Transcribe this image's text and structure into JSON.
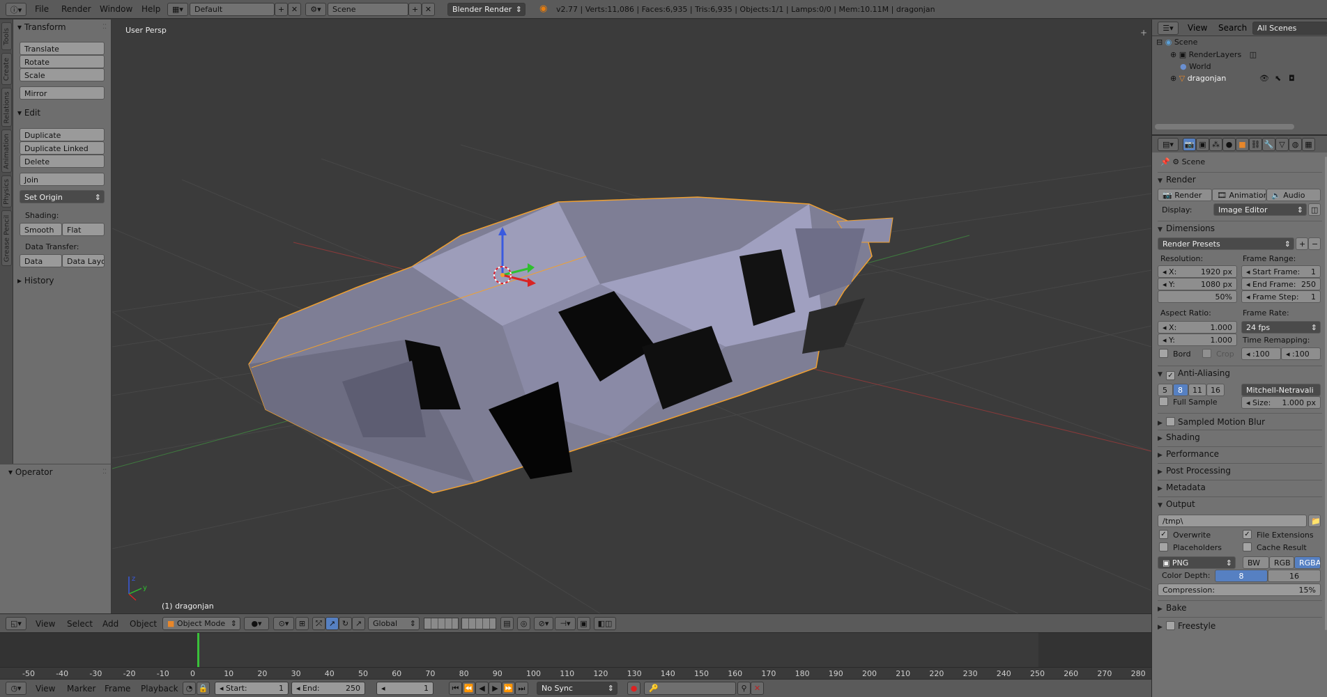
{
  "topbar": {
    "menus": [
      "File",
      "Render",
      "Window",
      "Help"
    ],
    "layout": "Default",
    "scene": "Scene",
    "engine": "Blender Render",
    "stats": "v2.77 | Verts:11,086 | Faces:6,935 | Tris:6,935 | Objects:1/1 | Lamps:0/0 | Mem:10.11M | dragonjan"
  },
  "tabs": [
    "Tools",
    "Create",
    "Relations",
    "Animation",
    "Physics",
    "Grease Pencil"
  ],
  "toolshelf": {
    "transform_header": "Transform",
    "translate": "Translate",
    "rotate": "Rotate",
    "scale": "Scale",
    "mirror": "Mirror",
    "edit_header": "Edit",
    "duplicate": "Duplicate",
    "duplicate_linked": "Duplicate Linked",
    "delete": "Delete",
    "join": "Join",
    "set_origin": "Set Origin",
    "shading_label": "Shading:",
    "smooth": "Smooth",
    "flat": "Flat",
    "data_transfer_label": "Data Transfer:",
    "data": "Data",
    "data_layout": "Data Layo",
    "history_header": "History",
    "operator_header": "Operator"
  },
  "viewport": {
    "view_name": "User Persp",
    "object_label": "(1) dragonjan"
  },
  "viewheader": {
    "menus": [
      "View",
      "Select",
      "Add",
      "Object"
    ],
    "mode": "Object Mode",
    "orientation": "Global"
  },
  "timeline": {
    "ticks": [
      "-50",
      "-40",
      "-30",
      "-20",
      "-10",
      "0",
      "10",
      "20",
      "30",
      "40",
      "50",
      "60",
      "70",
      "80",
      "90",
      "100",
      "110",
      "120",
      "130",
      "140",
      "150",
      "160",
      "170",
      "180",
      "190",
      "200",
      "210",
      "220",
      "230",
      "240",
      "250",
      "260",
      "270",
      "280"
    ],
    "current_frame": 1
  },
  "tlheader": {
    "menus": [
      "View",
      "Marker",
      "Frame",
      "Playback"
    ],
    "start_label": "Start:",
    "start_value": "1",
    "end_label": "End:",
    "end_value": "250",
    "current": "1",
    "sync": "No Sync"
  },
  "outliner": {
    "menus": [
      "View",
      "Search"
    ],
    "filter": "All Scenes",
    "items": [
      "Scene",
      "RenderLayers",
      "World",
      "dragonjan"
    ]
  },
  "properties": {
    "context": "Scene",
    "render_header": "Render",
    "render_btn": "Render",
    "animation_btn": "Animation",
    "audio_btn": "Audio",
    "display_label": "Display:",
    "display_value": "Image Editor",
    "dimensions_header": "Dimensions",
    "render_presets": "Render Presets",
    "resolution_label": "Resolution:",
    "res_x_label": "X:",
    "res_x": "1920 px",
    "res_y_label": "Y:",
    "res_y": "1080 px",
    "res_pct": "50%",
    "frame_range_label": "Frame Range:",
    "start_frame_label": "Start Frame:",
    "start_frame": "1",
    "end_frame_label": "End Frame:",
    "end_frame": "250",
    "frame_step_label": "Frame Step:",
    "frame_step": "1",
    "aspect_label": "Aspect Ratio:",
    "aspect_x": "1.000",
    "aspect_y": "1.000",
    "frame_rate_label": "Frame Rate:",
    "frame_rate": "24 fps",
    "time_remap_label": "Time Remapping:",
    "remap_old": ":100",
    "remap_new": ":100",
    "bord": "Bord",
    "crop": "Crop",
    "aa_header": "Anti-Aliasing",
    "aa_samples": [
      "5",
      "8",
      "11",
      "16"
    ],
    "aa_filter": "Mitchell-Netravali",
    "full_sample": "Full Sample",
    "size_label": "Size:",
    "size_value": "1.000 px",
    "motion_blur": "Sampled Motion Blur",
    "shading": "Shading",
    "performance": "Performance",
    "post_processing": "Post Processing",
    "metadata": "Metadata",
    "output_header": "Output",
    "output_path": "/tmp\\",
    "overwrite": "Overwrite",
    "file_extensions": "File Extensions",
    "placeholders": "Placeholders",
    "cache_result": "Cache Result",
    "format": "PNG",
    "bw": "BW",
    "rgb": "RGB",
    "rgba": "RGBA",
    "color_depth_label": "Color Depth:",
    "depth_8": "8",
    "depth_16": "16",
    "compression_label": "Compression:",
    "compression_value": "15%",
    "bake": "Bake",
    "freestyle": "Freestyle"
  },
  "colors": {
    "accent_blue": "#5680c2",
    "selection_orange": "#f0a030",
    "frame_green": "#3ac03a"
  }
}
